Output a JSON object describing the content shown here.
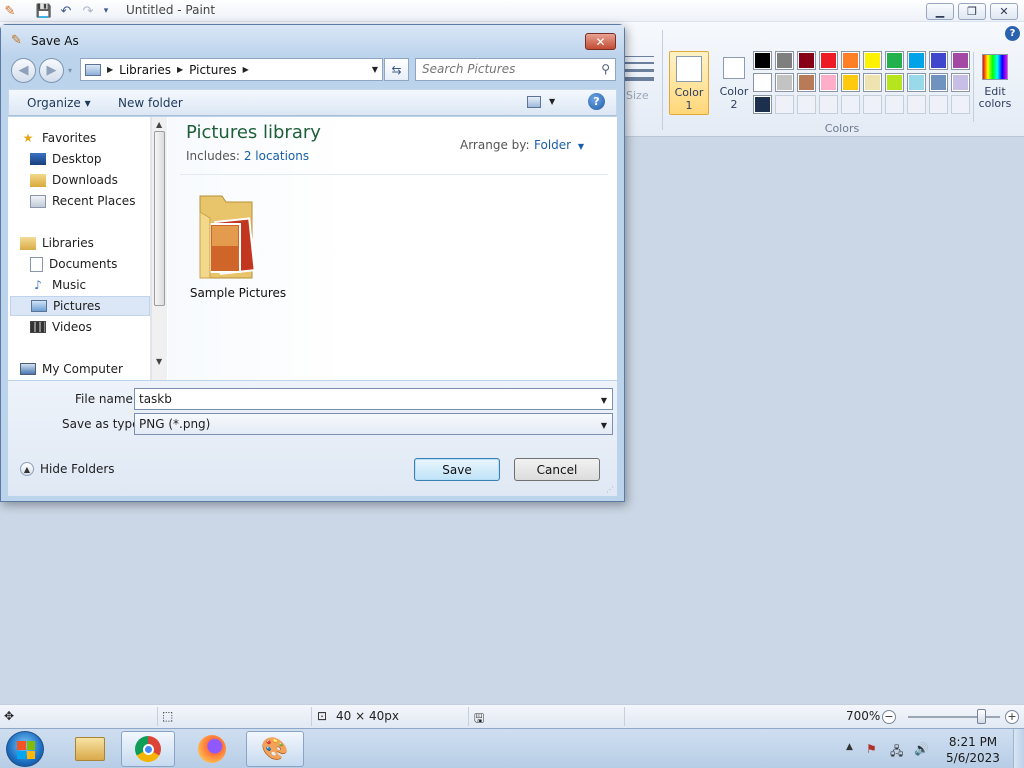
{
  "paint": {
    "title": "Untitled - Paint",
    "size_label": "Size",
    "color1_label_line1": "Color",
    "color1_label_line2": "1",
    "color2_label_line1": "Color",
    "color2_label_line2": "2",
    "colors_group_label": "Colors",
    "edit_colors_line1": "Edit",
    "edit_colors_line2": "colors",
    "palette": [
      [
        "#000000",
        "#7f7f7f",
        "#880015",
        "#ed1c24",
        "#ff7f27",
        "#fff200",
        "#22b14c",
        "#00a2e8",
        "#3f48cc",
        "#a349a4"
      ],
      [
        "#ffffff",
        "#c3c3c3",
        "#b97a57",
        "#ffaec9",
        "#ffc90e",
        "#efe4b0",
        "#b5e61d",
        "#99d9ea",
        "#7092be",
        "#c8bfe7"
      ],
      [
        "#1c2f4d",
        "",
        "",
        "",
        "",
        "",
        "",
        "",
        "",
        ""
      ]
    ]
  },
  "status": {
    "selection_size": "",
    "canvas_size": "40 × 40px",
    "zoom": "700%"
  },
  "dialog": {
    "title": "Save As",
    "breadcrumb": [
      "Libraries",
      "Pictures"
    ],
    "search_placeholder": "Search Pictures",
    "toolbar": {
      "organize": "Organize ▾",
      "new_folder": "New folder"
    },
    "nav": {
      "favorites": "Favorites",
      "desktop": "Desktop",
      "downloads": "Downloads",
      "recent_places": "Recent Places",
      "libraries": "Libraries",
      "documents": "Documents",
      "music": "Music",
      "pictures": "Pictures",
      "videos": "Videos",
      "my_computer": "My Computer"
    },
    "library_title": "Pictures library",
    "includes_label": "Includes:",
    "includes_link": "2 locations",
    "arrange_label": "Arrange by:",
    "arrange_value": "Folder",
    "folder_name": "Sample Pictures",
    "file_name_label": "File name:",
    "file_name_value": "taskb",
    "save_type_label": "Save as type:",
    "save_type_value": "PNG (*.png)",
    "save_button": "Save",
    "cancel_button": "Cancel",
    "hide_folders": "Hide Folders"
  },
  "taskbar": {
    "time": "8:21 PM",
    "date": "5/6/2023"
  }
}
